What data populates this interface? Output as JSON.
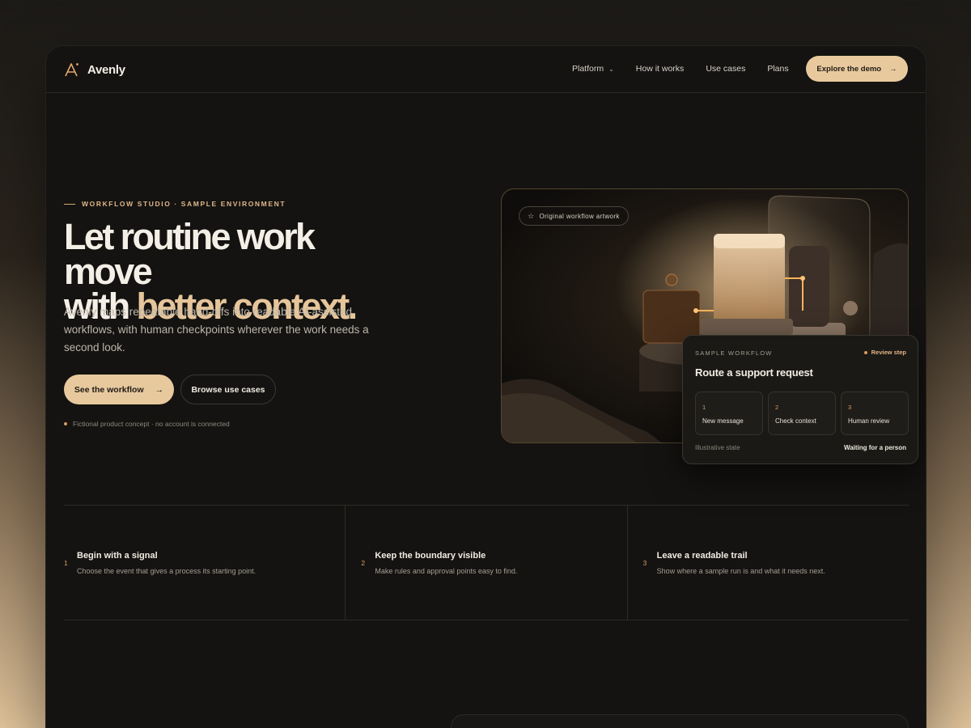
{
  "brand": {
    "name": "Avenly"
  },
  "nav": {
    "links": [
      "Platform",
      "How it works",
      "Use cases",
      "Plans"
    ],
    "cta": "Explore the demo"
  },
  "hero": {
    "eyebrow": "WORKFLOW STUDIO · SAMPLE ENVIRONMENT",
    "headline_line1": "Let routine work move",
    "headline_line2_plain": "with ",
    "headline_line2_accent": "better context.",
    "lede": "Avenly maps repeatable hand-offs into readable AI-assisted workflows, with human checkpoints wherever the work needs a second look.",
    "primary_button": "See the workflow",
    "secondary_button": "Browse use cases",
    "footnote": "Fictional product concept · no account is connected"
  },
  "art": {
    "badge": "Original workflow artwork"
  },
  "workflow_card": {
    "label": "SAMPLE WORKFLOW",
    "status": "Review step",
    "title": "Route a support request",
    "steps": [
      {
        "num": "1",
        "name": "New message"
      },
      {
        "num": "2",
        "name": "Check context"
      },
      {
        "num": "3",
        "name": "Human review"
      }
    ],
    "footer_left": "Illustrative state",
    "footer_right": "Waiting for a person"
  },
  "features": [
    {
      "num": "1",
      "title": "Begin with a signal",
      "desc": "Choose the event that gives a process its starting point."
    },
    {
      "num": "2",
      "title": "Keep the boundary visible",
      "desc": "Make rules and approval points easy to find."
    },
    {
      "num": "3",
      "title": "Leave a readable trail",
      "desc": "Show where a sample run is and what it needs next."
    }
  ],
  "colors": {
    "accent": "#e8c99e",
    "accent_text": "#e0b688",
    "background": "#141311"
  },
  "icons": {
    "logo": "avenly-logo-icon",
    "chevron": "chevron-down-icon",
    "arrow": "arrow-right-icon",
    "star": "star-icon"
  }
}
